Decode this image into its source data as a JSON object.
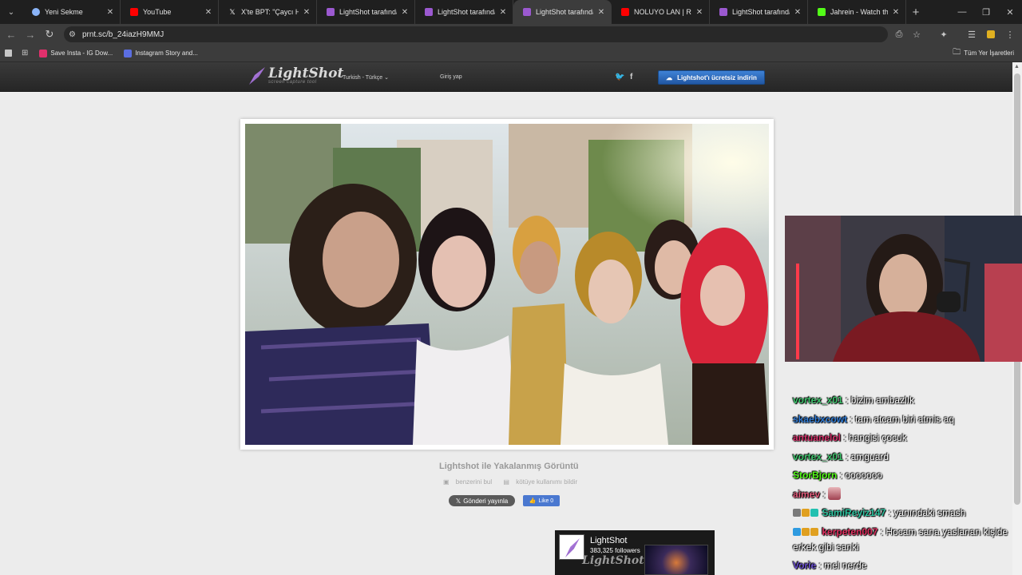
{
  "browser": {
    "tabs": [
      {
        "title": "Yeni Sekme",
        "color": "#8ab4f8"
      },
      {
        "title": "YouTube",
        "color": "#ff0000"
      },
      {
        "title": "X'te BPT: \"Çaycı Hüse",
        "color": "#ffffff"
      },
      {
        "title": "LightShot tarafından",
        "color": "#9b59d0"
      },
      {
        "title": "LightShot tarafından",
        "color": "#9b59d0"
      },
      {
        "title": "LightShot tarafından",
        "color": "#9b59d0"
      },
      {
        "title": "NOLUYO LAN | Rudo",
        "color": "#ff0000"
      },
      {
        "title": "LightShot tarafından",
        "color": "#9b59d0"
      },
      {
        "title": "Jahrein - Watch the",
        "color": "#53fc18"
      }
    ],
    "active_tab_index": 5,
    "url": "prnt.sc/b_24iazH9MMJ",
    "bookmarks": [
      {
        "label": "Save Insta - IG Dow...",
        "color": "#e1306c"
      },
      {
        "label": "Instagram Story and...",
        "color": "#5b6ee1"
      }
    ],
    "all_bookmarks_label": "Tüm Yer İşaretleri"
  },
  "lightshot": {
    "logo_title": "LightShot",
    "logo_sub": "screen capture tool",
    "language": "Turkish - Türkçe",
    "login": "Giriş yap",
    "download_button": "Lightshot'ı ücretsiz indirin",
    "caption_title": "Lightshot ile Yakalanmış Görüntü",
    "find_similar": "benzerini bul",
    "report": "kötüye kullanımı bildir",
    "share_button": "Gönderi yayınla",
    "like_button": "Like 0",
    "fb_widget": {
      "name": "LightShot",
      "followers": "383,325 followers",
      "watermark": "LightShot"
    }
  },
  "chat": [
    {
      "user": "vortex_x01",
      "color": "#3ec46d",
      "msg": ": bizim ambazlık",
      "badges": []
    },
    {
      "user": "skaebxcowt",
      "color": "#2f7bd6",
      "msg": ": tam atcam biri atmis aq",
      "badges": []
    },
    {
      "user": "antuanelol",
      "color": "#d6336c",
      "msg": ": hangisi çocuk",
      "badges": []
    },
    {
      "user": "vortex_x01",
      "color": "#3ec46d",
      "msg": ": amguard",
      "badges": []
    },
    {
      "user": "StorBjorn",
      "color": "#53fc18",
      "msg": ": ooooooo",
      "badges": []
    },
    {
      "user": "aimev",
      "color": "#e05a7a",
      "msg": ":",
      "badges": [],
      "emote": true
    },
    {
      "user": "SamiReyiz147",
      "color": "#2ec4a0",
      "msg": ": yanındaki smash",
      "badges": [
        "#7a7a7a",
        "#e0a020",
        "#22c0b0"
      ]
    },
    {
      "user": "kerpeten007",
      "color": "#e03060",
      "msg": ": Hocam sana yaslanan kişide erkek gibi sanki",
      "badges": [
        "#2f9be0",
        "#e0a020",
        "#e0a020"
      ]
    },
    {
      "user": "Vorie",
      "color": "#6a4fd0",
      "msg": ": mel nerde",
      "badges": []
    }
  ]
}
